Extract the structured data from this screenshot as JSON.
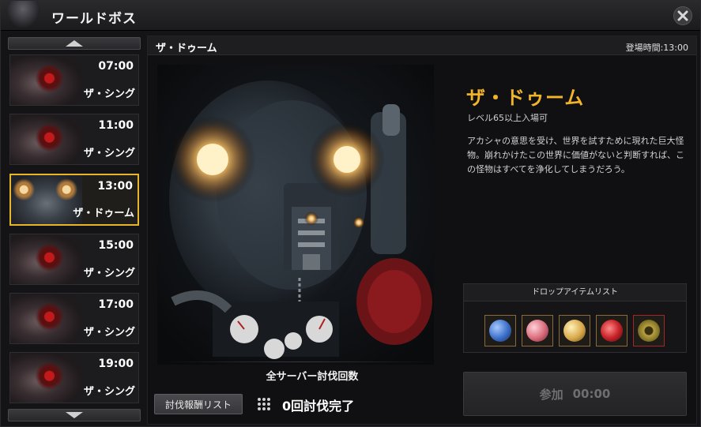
{
  "window": {
    "title": "ワールドボス"
  },
  "sidebar": {
    "slots": [
      {
        "time": "07:00",
        "name": "ザ・シング",
        "active": false
      },
      {
        "time": "11:00",
        "name": "ザ・シング",
        "active": false
      },
      {
        "time": "13:00",
        "name": "ザ・ドゥーム",
        "active": true
      },
      {
        "time": "15:00",
        "name": "ザ・シング",
        "active": false
      },
      {
        "time": "17:00",
        "name": "ザ・シング",
        "active": false
      },
      {
        "time": "19:00",
        "name": "ザ・シング",
        "active": false
      }
    ]
  },
  "boss": {
    "header_name": "ザ・ドゥーム",
    "appear_time": "登場時間:13:00",
    "title": "ザ・ドゥーム",
    "level": "レベル65以上入場可",
    "description": "アカシャの意思を受け、世界を試すために現れた巨大怪物。崩れかけたこの世界に価値がないと判断すれば、この怪物はすべてを浄化してしまうだろう。"
  },
  "kills": {
    "label": "全サーバー討伐回数",
    "reward_button": "討伐報酬リスト",
    "count_text": "0回討伐完了"
  },
  "drops": {
    "header": "ドロップアイテムリスト",
    "items": [
      {
        "icon": "blue-gem-icon",
        "color": "#3a6ec8"
      },
      {
        "icon": "pink-gem-icon",
        "color": "#d86a7a"
      },
      {
        "icon": "gold-gem-icon",
        "color": "#d8a84a"
      },
      {
        "icon": "red-crystal-icon",
        "color": "#c8242a"
      },
      {
        "icon": "bronze-disc-icon",
        "color": "#8a7a2a"
      }
    ]
  },
  "join": {
    "label": "参加",
    "timer": "00:00"
  },
  "colors": {
    "accent": "#f2b52a",
    "active_border": "#e7b52a"
  }
}
